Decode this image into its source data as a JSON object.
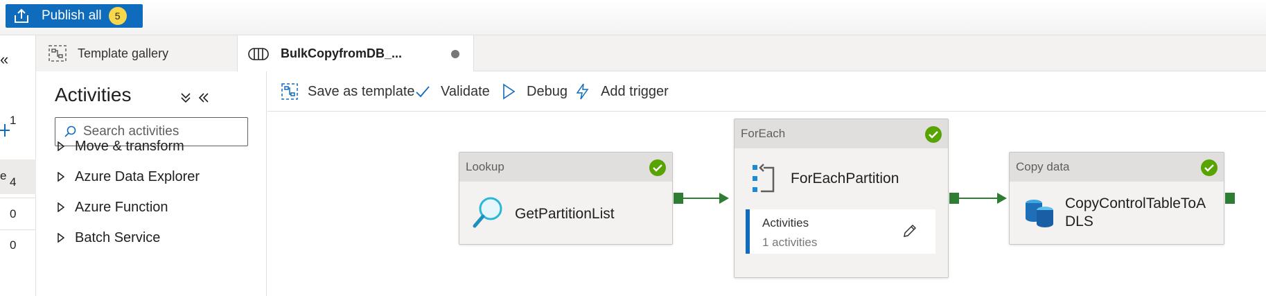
{
  "topbar": {
    "publish_label": "Publish all",
    "publish_count": "5"
  },
  "rail": {
    "collapse_glyph": "«",
    "selected_char": "e",
    "counts": [
      "1",
      "4",
      "0",
      "0"
    ]
  },
  "tabs": [
    {
      "label": "Template gallery",
      "icon": "template-icon"
    },
    {
      "label": "BulkCopyfromDB_...",
      "icon": "pipeline-icon",
      "unsaved": true
    }
  ],
  "activities": {
    "title": "Activities",
    "search_placeholder": "Search activities",
    "categories": [
      "Move & transform",
      "Azure Data Explorer",
      "Azure Function",
      "Batch Service"
    ]
  },
  "toolbar": {
    "save_template": "Save as template",
    "validate": "Validate",
    "debug": "Debug",
    "add_trigger": "Add trigger"
  },
  "nodes": {
    "lookup": {
      "type": "Lookup",
      "name": "GetPartitionList",
      "status": "success"
    },
    "foreach": {
      "type": "ForEach",
      "name": "ForEachPartition",
      "status": "success",
      "inner_label": "Activities",
      "inner_count": "1 activities"
    },
    "copy": {
      "type": "Copy data",
      "name_line1": "CopyControlTableToA",
      "name_line2": "DLS",
      "status": "success"
    }
  },
  "colors": {
    "accent": "#0f6cbd",
    "success": "#57a300",
    "connector": "#2e7d32",
    "badge": "#f8d74a"
  }
}
